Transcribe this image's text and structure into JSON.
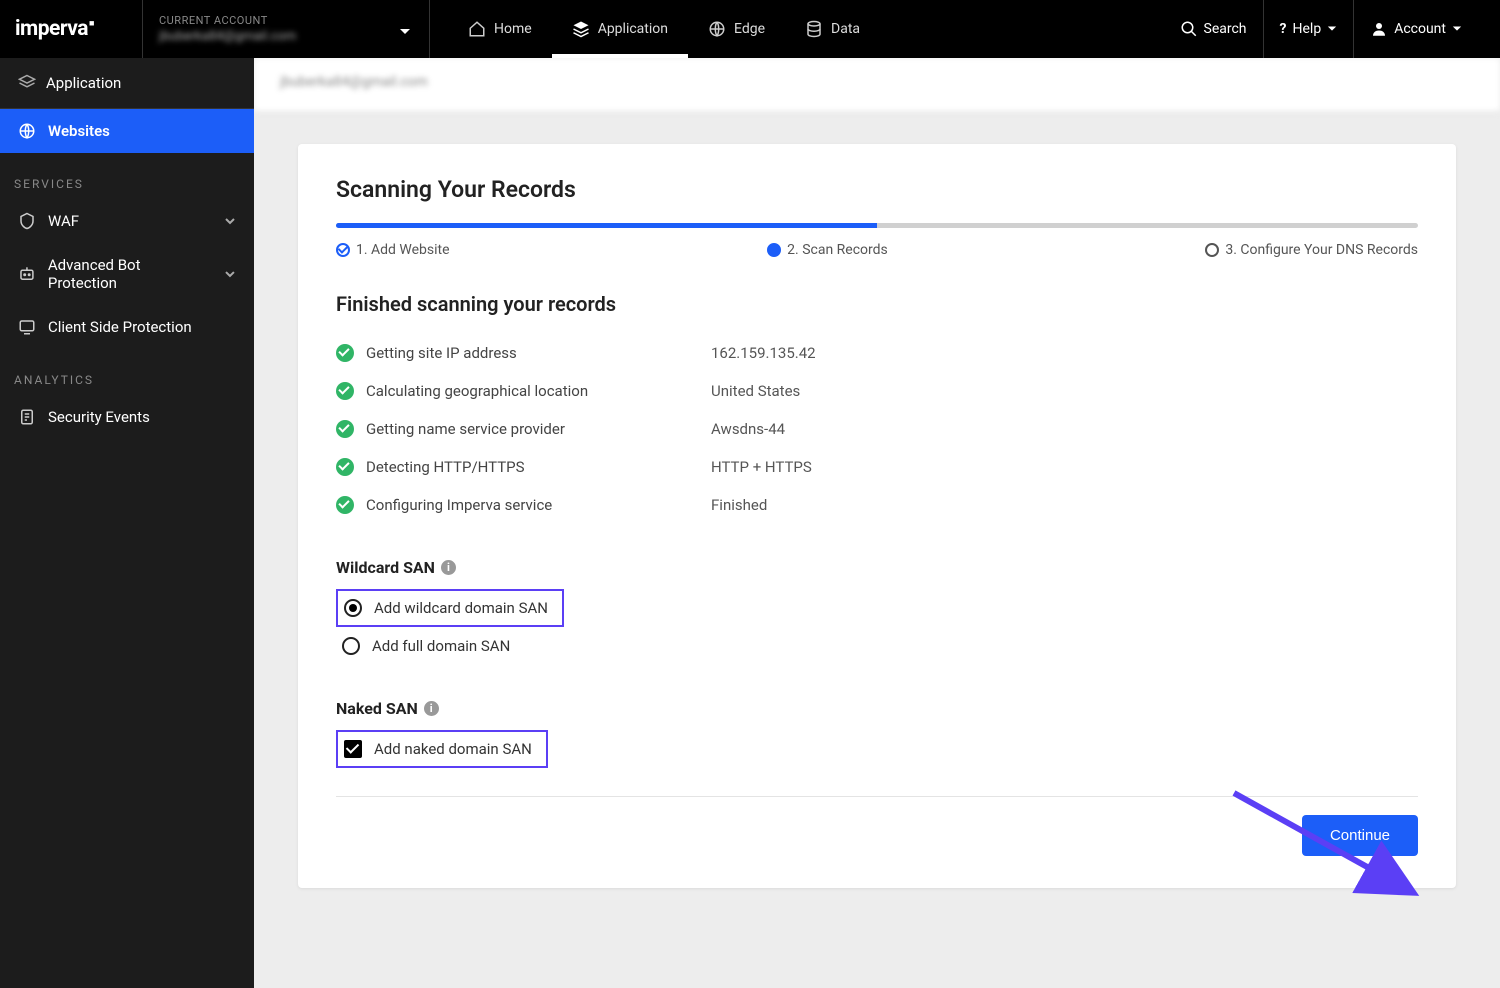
{
  "header": {
    "logo": "imperva",
    "account_label": "CURRENT ACCOUNT",
    "account_email": "jbuberka84@gmail.com",
    "nav": {
      "home": "Home",
      "application": "Application",
      "edge": "Edge",
      "data": "Data"
    },
    "search": "Search",
    "help": "Help",
    "account": "Account"
  },
  "sidebar": {
    "app_root": "Application",
    "websites": "Websites",
    "services_label": "SERVICES",
    "waf": "WAF",
    "abp": "Advanced Bot Protection",
    "csp": "Client Side Protection",
    "analytics_label": "ANALYTICS",
    "sec_events": "Security Events"
  },
  "breadcrumb": "jbuberka84@gmail.com",
  "page": {
    "title": "Scanning Your Records",
    "steps": {
      "s1": "1. Add Website",
      "s2": "2. Scan Records",
      "s3": "3. Configure Your DNS Records"
    },
    "subtitle": "Finished scanning your records",
    "scan": [
      {
        "label": "Getting site IP address",
        "value": "162.159.135.42"
      },
      {
        "label": "Calculating geographical location",
        "value": "United States"
      },
      {
        "label": "Getting name service provider",
        "value": "Awsdns-44"
      },
      {
        "label": "Detecting HTTP/HTTPS",
        "value": "HTTP + HTTPS"
      },
      {
        "label": "Configuring Imperva service",
        "value": "Finished"
      }
    ],
    "wildcard_title": "Wildcard SAN",
    "wildcard_opt1": "Add wildcard domain SAN",
    "wildcard_opt2": "Add full domain SAN",
    "naked_title": "Naked SAN",
    "naked_opt": "Add naked domain SAN",
    "continue": "Continue"
  }
}
